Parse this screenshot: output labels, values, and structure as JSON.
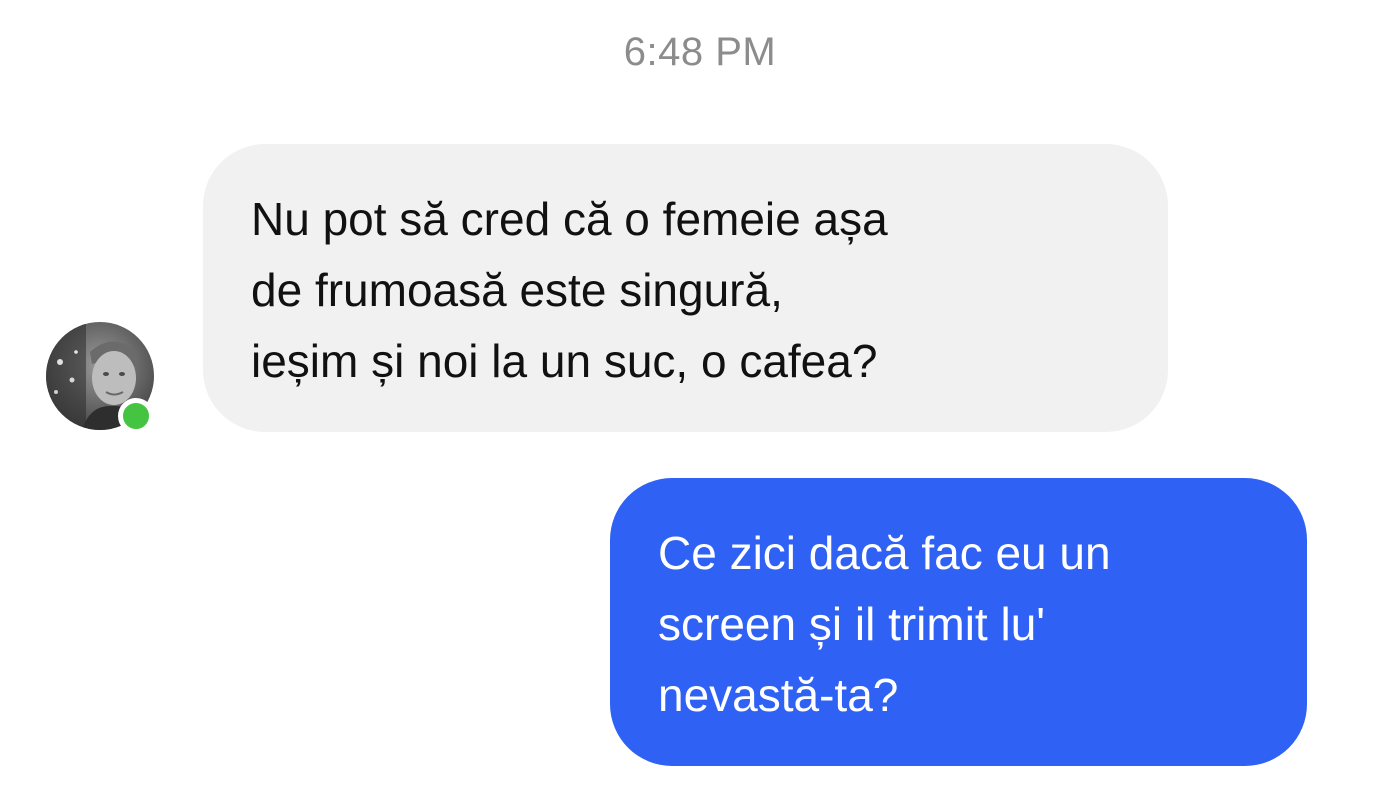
{
  "conversation": {
    "timestamp": "6:48 PM",
    "messages": [
      {
        "direction": "incoming",
        "text": "Nu pot să cred că o femeie așa\nde frumoasă este singură,\nieșim și noi la un suc, o cafea?"
      },
      {
        "direction": "outgoing",
        "text": "Ce zici dacă fac eu un\nscreen și il trimit lu'\nnevastă-ta?"
      }
    ],
    "sender": {
      "avatar_icon": "user-avatar-photo",
      "online": true
    }
  },
  "colors": {
    "incoming_bubble": "#f1f1f1",
    "outgoing_bubble": "#2f62f4",
    "online_indicator": "#44c441",
    "timestamp_text": "#8c8c8c"
  }
}
